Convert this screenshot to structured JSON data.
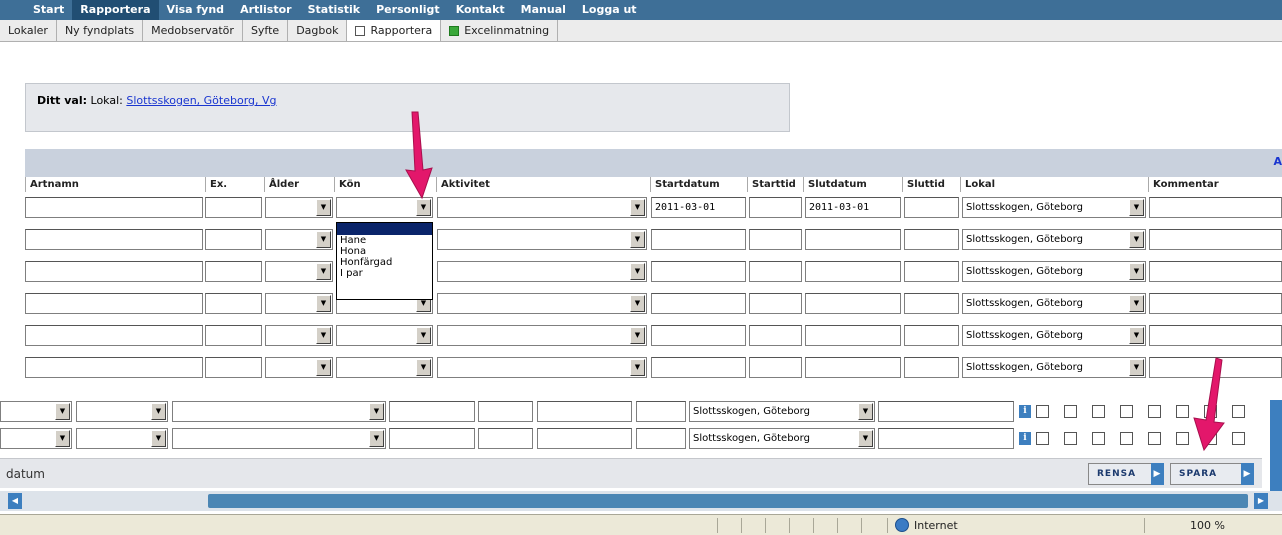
{
  "nav": {
    "items": [
      "Start",
      "Rapportera",
      "Visa fynd",
      "Artlistor",
      "Statistik",
      "Personligt",
      "Kontakt",
      "Manual",
      "Logga ut"
    ],
    "active": "Rapportera"
  },
  "subnav": {
    "items": [
      "Lokaler",
      "Ny fyndplats",
      "Medobservatör",
      "Syfte",
      "Dagbok",
      "Rapportera",
      "Excelinmatning"
    ],
    "active": "Rapportera"
  },
  "choice": {
    "label": "Ditt val:",
    "prefix": "Lokal:",
    "link": "Slottsskogen, Göteborg, Vg"
  },
  "grid": {
    "header_right": "A",
    "columns": [
      "Artnamn",
      "Ex.",
      "Ålder",
      "Kön",
      "Aktivitet",
      "Startdatum",
      "Starttid",
      "Slutdatum",
      "Sluttid",
      "Lokal",
      "Kommentar"
    ],
    "first_row": {
      "startdatum": "2011-03-01",
      "slutdatum": "2011-03-01"
    },
    "lokal_value": "Slottsskogen, Göteborg",
    "dropdown_open": {
      "field": "Kön",
      "options": [
        "Hane",
        "Hona",
        "Honfärgad",
        "I par"
      ]
    }
  },
  "lower": {
    "lokal_value": "Slottsskogen, Göteborg",
    "date_label": "datum",
    "buttons": {
      "clear": "RENSA",
      "save": "SPARA"
    },
    "info_icon": "i"
  },
  "statusbar": {
    "zone": "Internet",
    "zoom": "100 %"
  },
  "colors": {
    "nav_bg": "#3e6f97",
    "accent": "#3d7fbf",
    "arrow": "#e3176b"
  }
}
